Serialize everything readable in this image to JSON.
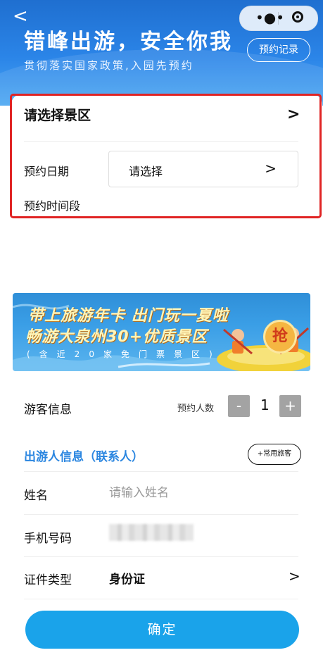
{
  "nav": {
    "back_glyph": "<",
    "more_glyph": "•●•"
  },
  "hero": {
    "title": "错峰出游，安全你我",
    "subtitle": "贯彻落实国家政策,入园先预约",
    "records_button": "预约记录"
  },
  "booking": {
    "scenic_label": "请选择景区",
    "scenic_arrow": ">",
    "date_label": "预约日期",
    "date_value": "请选择",
    "date_arrow": ">",
    "time_label": "预约时间段"
  },
  "banner": {
    "line1": "带上旅游年卡 出门玩一夏啦",
    "line2": "畅游大泉州30+优质景区",
    "line3": "(含近20家免门票景区)",
    "badge": "抢"
  },
  "visitor": {
    "label": "游客信息",
    "count_label": "预约人数",
    "minus": "-",
    "plus": "+",
    "count": "1"
  },
  "traveler": {
    "header": "出游人信息（联系人）",
    "common_button": "+常用旅客",
    "name_label": "姓名",
    "name_placeholder": "请输入姓名",
    "phone_label": "手机号码",
    "id_type_label": "证件类型",
    "id_type_value": "身份证",
    "id_arrow": ">"
  },
  "confirm_button": "确定",
  "colors": {
    "primary": "#1aa3ea",
    "accent_text": "#2b86e0",
    "highlight": "#e02424"
  },
  "icons": [
    "back-icon",
    "more-icon",
    "close-mini-program-icon",
    "chevron-right-icon"
  ]
}
